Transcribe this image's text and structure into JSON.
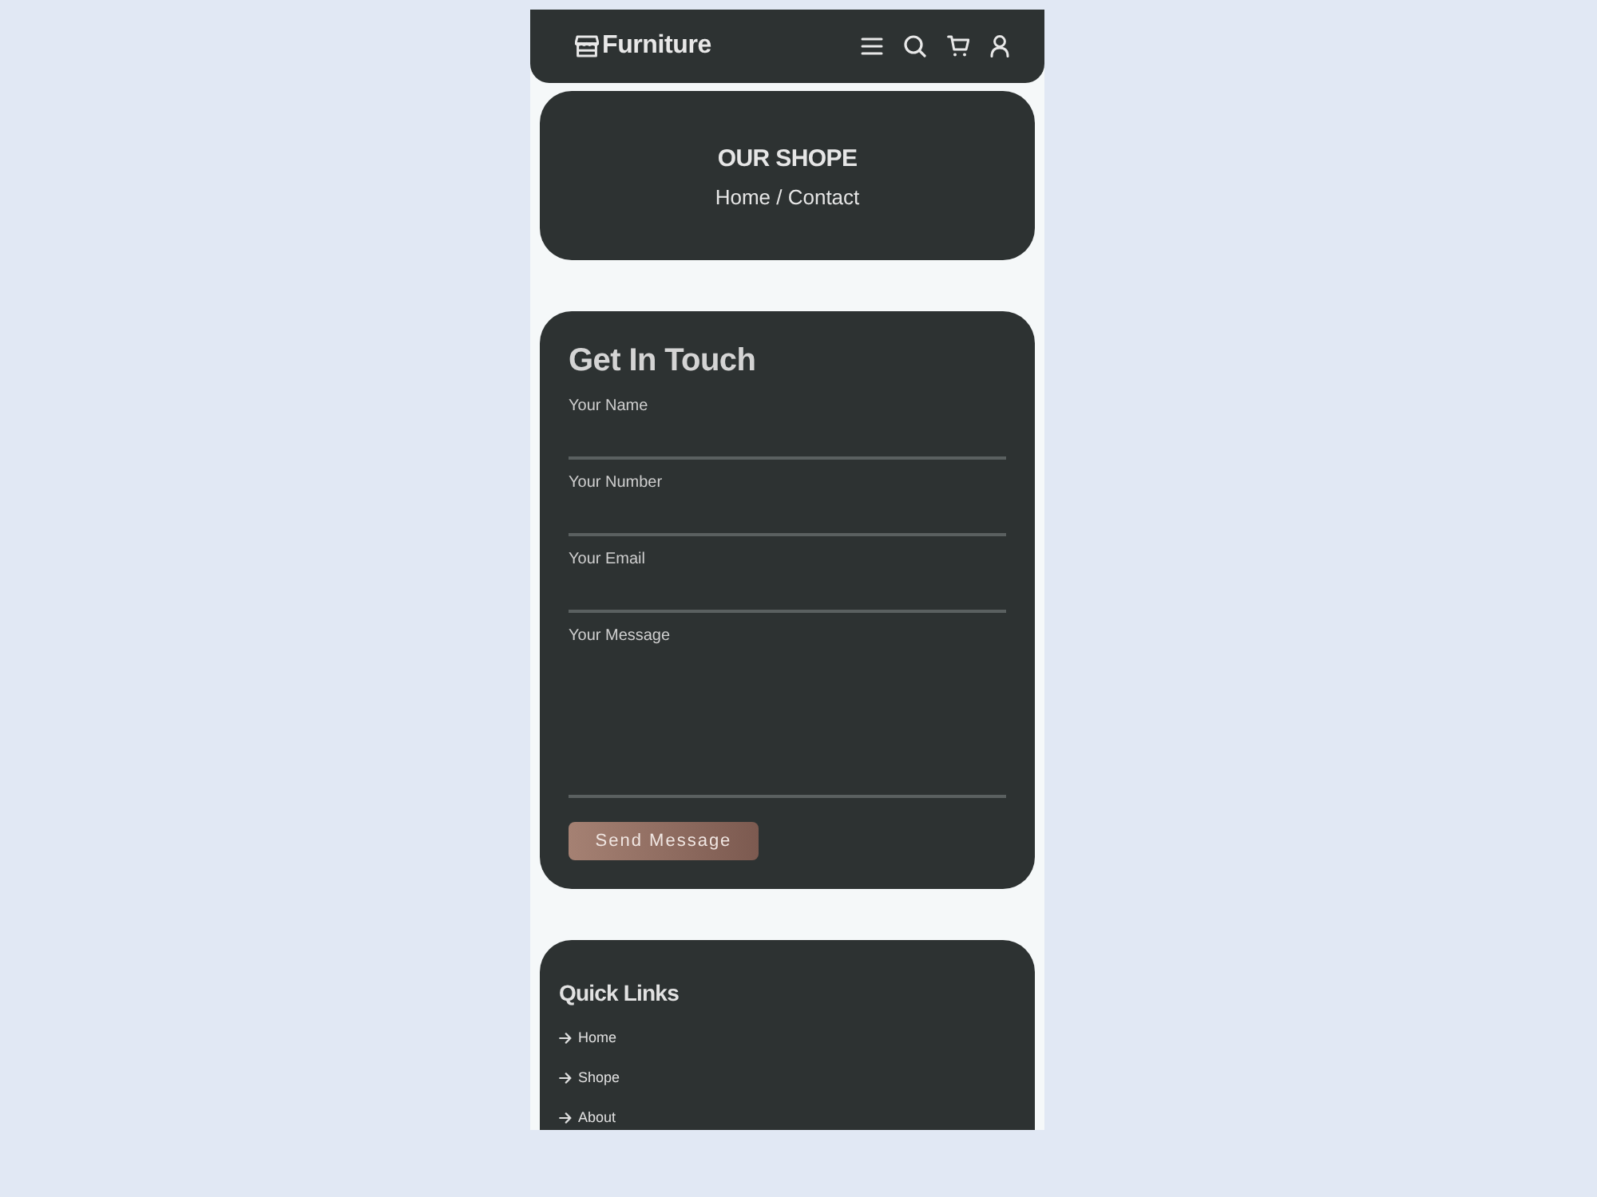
{
  "header": {
    "logo": "Furniture"
  },
  "hero": {
    "title": "OUR SHOPE",
    "breadcrumb": "Home / Contact"
  },
  "contact_form": {
    "title": "Get In Touch",
    "fields": [
      {
        "label": "Your Name",
        "kind": "input"
      },
      {
        "label": "Your Number",
        "kind": "input"
      },
      {
        "label": "Your Email",
        "kind": "input"
      },
      {
        "label": "Your Message",
        "kind": "textarea"
      }
    ],
    "submit": "Send Message"
  },
  "footer": {
    "title": "Quick Links",
    "links": [
      "Home",
      "Shope",
      "About"
    ]
  }
}
